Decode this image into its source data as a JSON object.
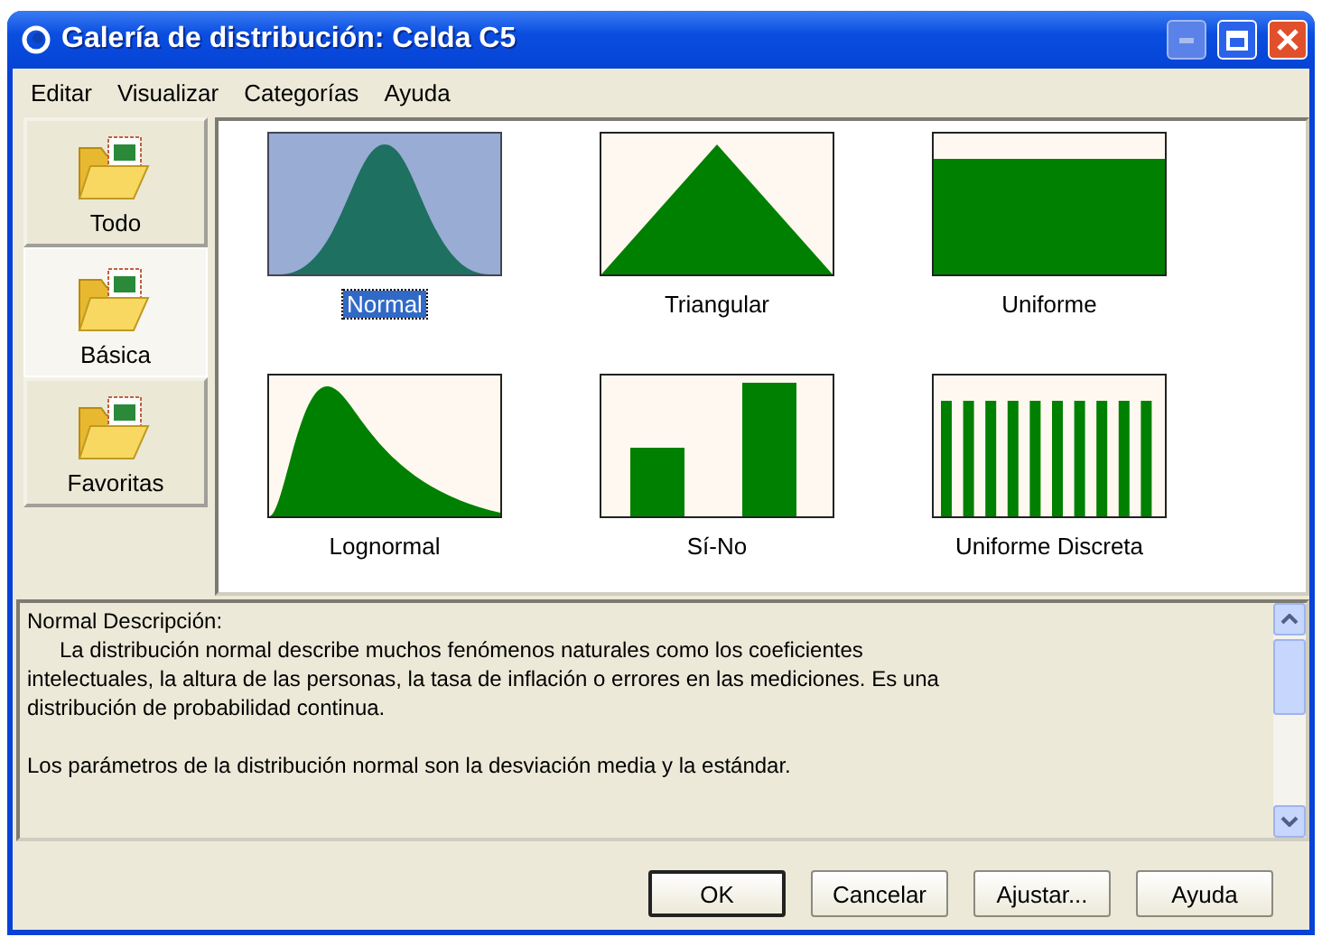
{
  "window": {
    "title": "Galería de distribución: Celda C5"
  },
  "menu": [
    "Editar",
    "Visualizar",
    "Categorías",
    "Ayuda"
  ],
  "categories": [
    {
      "label": "Todo",
      "selected": false
    },
    {
      "label": "Básica",
      "selected": true
    },
    {
      "label": "Favoritas",
      "selected": false
    }
  ],
  "distributions": [
    {
      "label": "Normal",
      "kind": "normal",
      "selected": true
    },
    {
      "label": "Triangular",
      "kind": "triangular",
      "selected": false
    },
    {
      "label": "Uniforme",
      "kind": "uniform",
      "selected": false
    },
    {
      "label": "Lognormal",
      "kind": "lognormal",
      "selected": false
    },
    {
      "label": "Sí-No",
      "kind": "yesno",
      "selected": false
    },
    {
      "label": "Uniforme Discreta",
      "kind": "discrete",
      "selected": false
    }
  ],
  "description": {
    "heading": "Normal Descripción:",
    "paragraphs": [
      "La distribución normal describe muchos fenómenos naturales como los coeficientes intelectuales, la altura de las personas, la tasa de inflación o errores en las mediciones. Es una distribución de probabilidad continua.",
      "Los parámetros de la distribución normal son la desviación media y la estándar."
    ]
  },
  "buttons": [
    {
      "label": "OK",
      "default": true
    },
    {
      "label": "Cancelar",
      "default": false
    },
    {
      "label": "Ajustar...",
      "default": false
    },
    {
      "label": "Ayuda",
      "default": false
    }
  ]
}
